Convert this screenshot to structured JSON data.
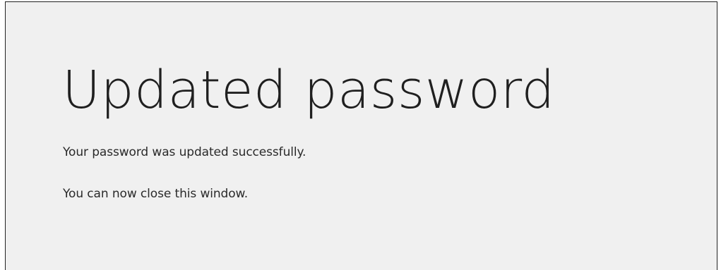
{
  "page": {
    "title": "Updated password",
    "message": "Your password was updated successfully.",
    "instruction": "You can now close this window."
  },
  "colors": {
    "background": "#f0f0f0",
    "border": "#222222",
    "text": "#1f1f1f"
  }
}
